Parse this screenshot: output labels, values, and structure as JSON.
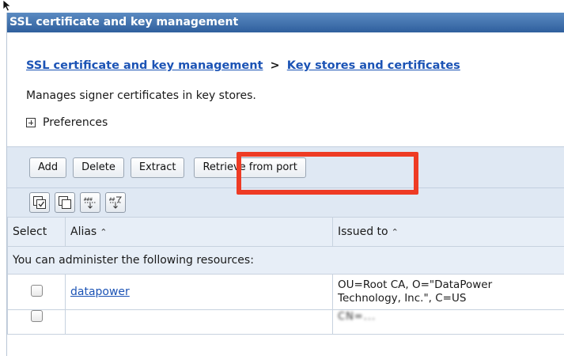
{
  "panel": {
    "title": "SSL certificate and key management"
  },
  "breadcrumb": {
    "link1": "SSL certificate and key management",
    "separator": ">",
    "link2": "Key stores and certificates"
  },
  "description": "Manages signer certificates in key stores.",
  "preferences_label": "Preferences",
  "toolbar": {
    "add_label": "Add",
    "delete_label": "Delete",
    "extract_label": "Extract",
    "retrieve_label": "Retrieve from port"
  },
  "icon_toolbar": {
    "icons": [
      "select-all-icon",
      "deselect-all-icon",
      "show-filter-icon",
      "clear-filter-icon"
    ]
  },
  "table": {
    "headers": {
      "select": "Select",
      "alias": "Alias",
      "issued_to": "Issued to"
    },
    "group_text": "You can administer the following resources:",
    "rows": [
      {
        "alias": "datapower",
        "issued_to_line1": "OU=Root CA, O=\"DataPower",
        "issued_to_line2": "Technology, Inc.\", C=US"
      },
      {
        "alias": "",
        "issued_to_line1": "CN=...",
        "issued_to_line2": ""
      }
    ]
  },
  "colors": {
    "title_bar": "#2f5f9d",
    "link": "#1b53b5",
    "toolbar_bg": "#dfe8f3",
    "highlight": "#ee3b24"
  }
}
